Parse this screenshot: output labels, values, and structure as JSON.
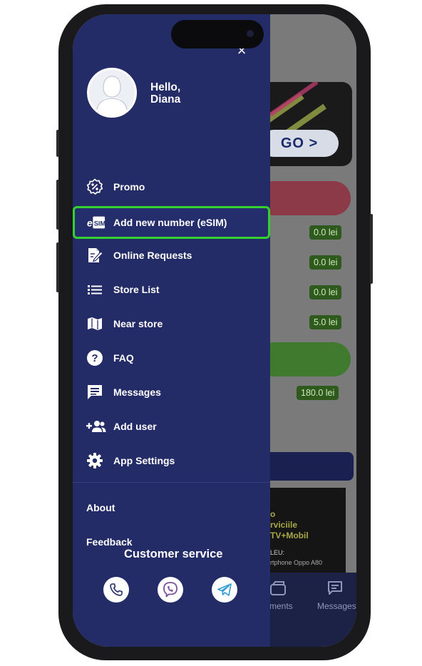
{
  "background_app": {
    "promo_button_label": "GO >",
    "amounts": [
      "0.0 lei",
      "0.0 lei",
      "0.0 lei",
      "5.0 lei",
      "180.0 lei"
    ],
    "poster_lines": [
      "o",
      "rviciile",
      "TV+Mobil",
      "LEU:",
      "rtphone Oppo A80"
    ],
    "tabs": [
      "rments",
      "Messages"
    ]
  },
  "drawer": {
    "close_label": "×",
    "greeting": {
      "line1": "Hello,",
      "line2": "Diana"
    },
    "menu": [
      {
        "label": "Promo",
        "icon": "percent-badge-icon"
      },
      {
        "label": "Add new number (eSIM)",
        "icon": "esim-icon",
        "highlighted": true
      },
      {
        "label": "Online Requests",
        "icon": "edit-document-icon"
      },
      {
        "label": "Store List",
        "icon": "list-icon"
      },
      {
        "label": "Near store",
        "icon": "map-icon"
      },
      {
        "label": "FAQ",
        "icon": "help-circle-icon"
      },
      {
        "label": "Messages",
        "icon": "chat-icon"
      },
      {
        "label": "Add user",
        "icon": "add-user-icon"
      },
      {
        "label": "App Settings",
        "icon": "gear-icon"
      }
    ],
    "links": {
      "about": "About",
      "feedback": "Feedback"
    },
    "customer_service": {
      "title": "Customer service",
      "contacts": [
        "phone-icon",
        "viber-icon",
        "telegram-icon"
      ]
    }
  },
  "colors": {
    "drawer_bg": "#232c66",
    "highlight_border": "#34d12f",
    "pill_bg": "#2f5a1e"
  }
}
